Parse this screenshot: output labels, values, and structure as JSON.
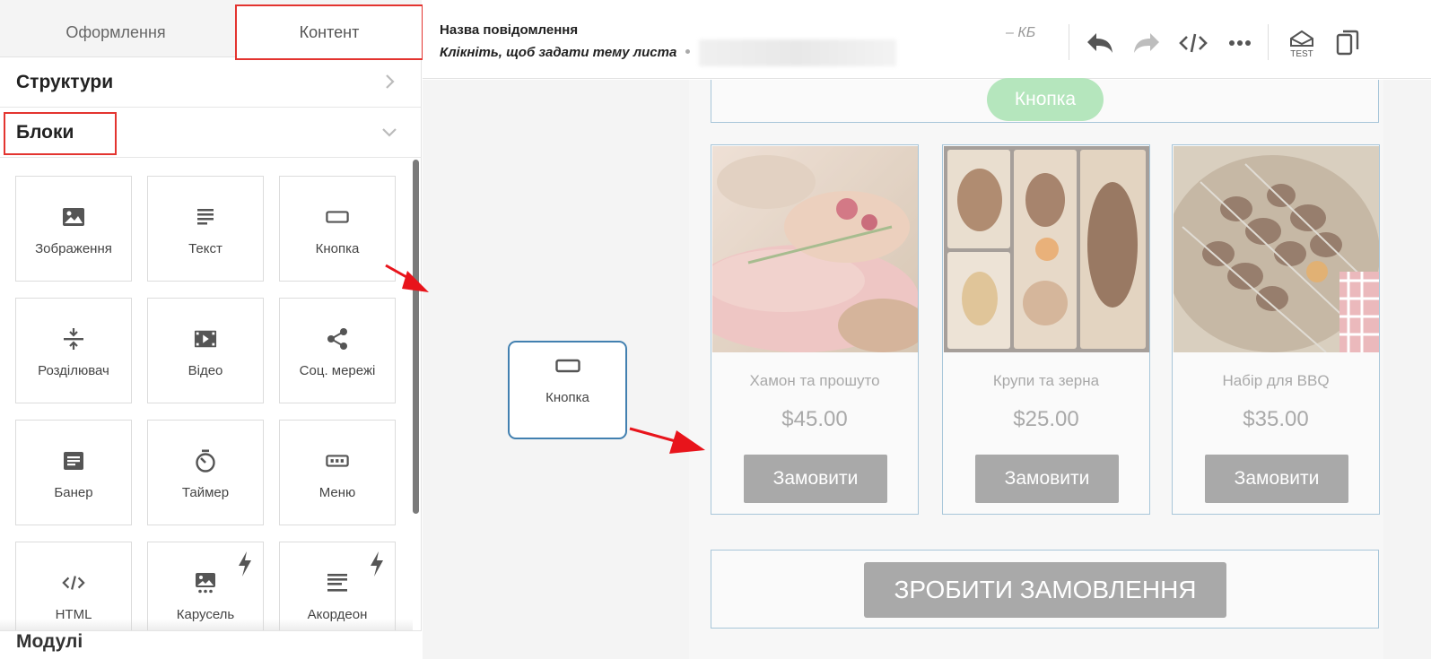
{
  "tabs": {
    "design": "Оформлення",
    "content": "Контент"
  },
  "sections": {
    "structures": "Структури",
    "blocks": "Блоки",
    "modules": "Модулі"
  },
  "blocks": [
    {
      "label": "Зображення",
      "icon": "image-icon",
      "fast": false
    },
    {
      "label": "Текст",
      "icon": "text-icon",
      "fast": false
    },
    {
      "label": "Кнопка",
      "icon": "button-icon",
      "fast": false
    },
    {
      "label": "Розділювач",
      "icon": "divider-icon",
      "fast": false
    },
    {
      "label": "Відео",
      "icon": "video-icon",
      "fast": false
    },
    {
      "label": "Соц. мережі",
      "icon": "share-icon",
      "fast": false
    },
    {
      "label": "Банер",
      "icon": "banner-icon",
      "fast": false
    },
    {
      "label": "Таймер",
      "icon": "timer-icon",
      "fast": false
    },
    {
      "label": "Меню",
      "icon": "menu-icon",
      "fast": false
    },
    {
      "label": "HTML",
      "icon": "code-icon",
      "fast": false
    },
    {
      "label": "Карусель",
      "icon": "carousel-icon",
      "fast": true
    },
    {
      "label": "Акордеон",
      "icon": "accordion-icon",
      "fast": true
    }
  ],
  "header": {
    "message_name": "Назва повідомлення",
    "subject_placeholder": "Клікніть, щоб задати тему листа",
    "size": "– КБ",
    "test_label": "TEST"
  },
  "email": {
    "top_button": "Кнопка",
    "products": [
      {
        "title": "Хамон та прошуто",
        "price": "$45.00",
        "button": "Замовити"
      },
      {
        "title": "Крупи та зерна",
        "price": "$25.00",
        "button": "Замовити"
      },
      {
        "title": "Набір для BBQ",
        "price": "$35.00",
        "button": "Замовити"
      }
    ],
    "cta": "ЗРОБИТИ ЗАМОВЛЕННЯ"
  },
  "drag_tile": {
    "label": "Кнопка"
  },
  "colors": {
    "highlight": "#e3342f",
    "drag_border": "#4280b0",
    "arrow": "#e8141b",
    "green_button": "#b5e6bd",
    "muted_button": "#a9a9a9"
  }
}
